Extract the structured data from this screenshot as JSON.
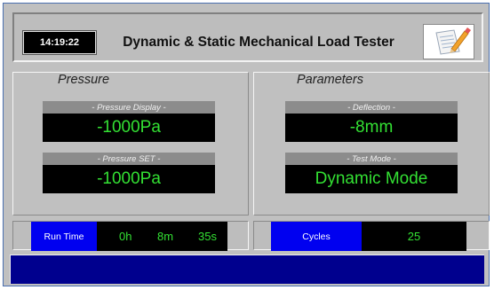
{
  "header": {
    "clock": "14:19:22",
    "title": "Dynamic & Static Mechanical Load Tester",
    "logo_icon": "notepad-pencil-icon"
  },
  "pressure_panel": {
    "title": "Pressure",
    "pressure_display": {
      "label": "- Pressure Display -",
      "value": "-1000Pa"
    },
    "pressure_set": {
      "label": "- Pressure SET -",
      "value": "-1000Pa"
    }
  },
  "parameters_panel": {
    "title": "Parameters",
    "deflection": {
      "label": "- Deflection -",
      "value": "-8mm"
    },
    "test_mode": {
      "label": "- Test Mode -",
      "value": "Dynamic Mode"
    }
  },
  "run_time": {
    "label": "Run Time",
    "hours": "0h",
    "minutes": "8m",
    "seconds": "35s"
  },
  "cycles": {
    "label": "Cycles",
    "value": "25"
  },
  "colors": {
    "background": "#c0c0c0",
    "value_text": "#33e033",
    "blue_label": "#0000f0",
    "status_bar": "#00008e"
  }
}
